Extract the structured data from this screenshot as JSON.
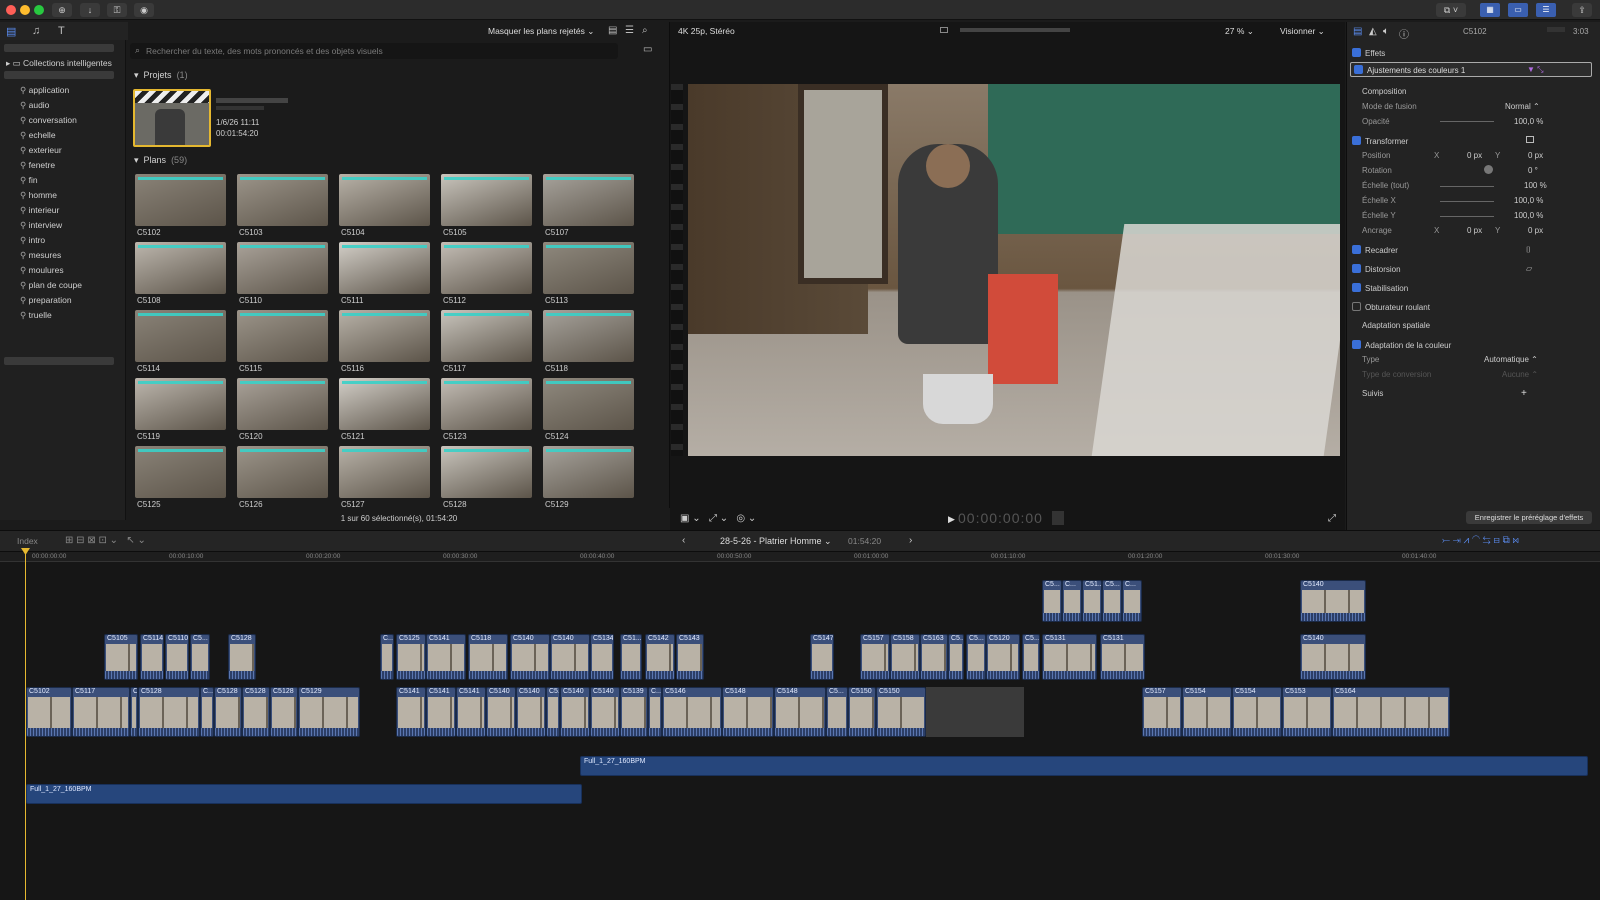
{
  "library": {
    "items": [
      "Collections intelligentes",
      "application",
      "audio",
      "conversation",
      "echelle",
      "exterieur",
      "fenetre",
      "fin",
      "homme",
      "interieur",
      "interview",
      "intro",
      "mesures",
      "moulures",
      "plan de coupe",
      "preparation",
      "truelle"
    ]
  },
  "browser": {
    "filter": "Masquer les plans rejetés",
    "search_placeholder": "Rechercher du texte, des mots prononcés et des objets visuels",
    "projects_label": "Projets",
    "projects_count": "(1)",
    "project_date": "1/6/26 11:11",
    "project_duration": "00:01:54:20",
    "plans_label": "Plans",
    "plans_count": "(59)",
    "clips": [
      "C5102",
      "C5103",
      "C5104",
      "C5105",
      "C5107",
      "C5108",
      "C5110",
      "C5111",
      "C5112",
      "C5113",
      "C5114",
      "C5115",
      "C5116",
      "C5117",
      "C5118",
      "C5119",
      "C5120",
      "C5121",
      "C5123",
      "C5124",
      "C5125",
      "C5126",
      "C5127",
      "C5128",
      "C5129"
    ],
    "status": "1 sur 60 sélectionné(s), 01:54:20"
  },
  "viewer": {
    "format": "4K 25p, Stéréo",
    "zoom": "27 %",
    "view_menu": "Visionner",
    "timecode": "00:00:00:00"
  },
  "inspector": {
    "clip_name": "C5102",
    "duration": "3:03",
    "effects": "Effets",
    "color_adjust": "Ajustements des couleurs 1",
    "composition": "Composition",
    "blend_mode_label": "Mode de fusion",
    "blend_mode_value": "Normal",
    "opacity_label": "Opacité",
    "opacity_value": "100,0 %",
    "transform": "Transformer",
    "position": "Position",
    "pos_x": "0 px",
    "pos_y": "0 px",
    "rotation": "Rotation",
    "rotation_value": "0 °",
    "scale_all": "Échelle (tout)",
    "scale_all_value": "100 %",
    "scale_x": "Échelle X",
    "scale_x_value": "100,0 %",
    "scale_y": "Échelle Y",
    "scale_y_value": "100,0 %",
    "anchor": "Ancrage",
    "anchor_x": "0 px",
    "anchor_y": "0 px",
    "crop": "Recadrer",
    "distortion": "Distorsion",
    "stabilization": "Stabilisation",
    "rolling_shutter": "Obturateur roulant",
    "spatial": "Adaptation spatiale",
    "color_conform": "Adaptation de la couleur",
    "type_label": "Type",
    "type_value": "Automatique",
    "conversion_label": "Type de conversion",
    "conversion_value": "Aucune",
    "tracks": "Suivis",
    "save_preset": "Enregistrer le préréglage d'effets"
  },
  "timeline": {
    "index": "Index",
    "project_name": "28-5-26 - Platrier Homme",
    "duration": "01:54:20",
    "ruler": [
      "00:00:00:00",
      "00:00:10:00",
      "00:00:20:00",
      "00:00:30:00",
      "00:00:40:00",
      "00:00:50:00",
      "00:01:00:00",
      "00:01:10:00",
      "00:01:20:00",
      "00:01:30:00",
      "00:01:40:00"
    ],
    "audio_a": "Full_1_27_160BPM",
    "audio_b": "Full_1_27_160BPM",
    "primary_clips": [
      "C5102",
      "C5117",
      "C",
      "C5128",
      "C...",
      "C5128",
      "C5128",
      "C5128",
      "C5129",
      "C5141",
      "C5141",
      "C5141",
      "C5140",
      "C5140",
      "C5...",
      "C5140",
      "C5140",
      "C5139",
      "C...",
      "C5146",
      "C5148",
      "C5148",
      "C5...",
      "C5150",
      "C5150",
      "C5157",
      "C5154",
      "C5154",
      "C5153",
      "C5164"
    ],
    "connected_clips": [
      "C5105",
      "C5114",
      "C5110",
      "C5...",
      "C5128",
      "C...",
      "C5125",
      "C5141",
      "C5118",
      "C5140",
      "C5140",
      "C5134",
      "C51...",
      "C5142",
      "C5143",
      "C5147",
      "C5157",
      "C5158",
      "C5163",
      "C5...",
      "C5...",
      "C5120",
      "C5...",
      "C5131",
      "C5131",
      "C5140"
    ],
    "upper_clips": [
      "C5...",
      "C...",
      "C51...",
      "C5...",
      "C...",
      "C5140"
    ]
  }
}
